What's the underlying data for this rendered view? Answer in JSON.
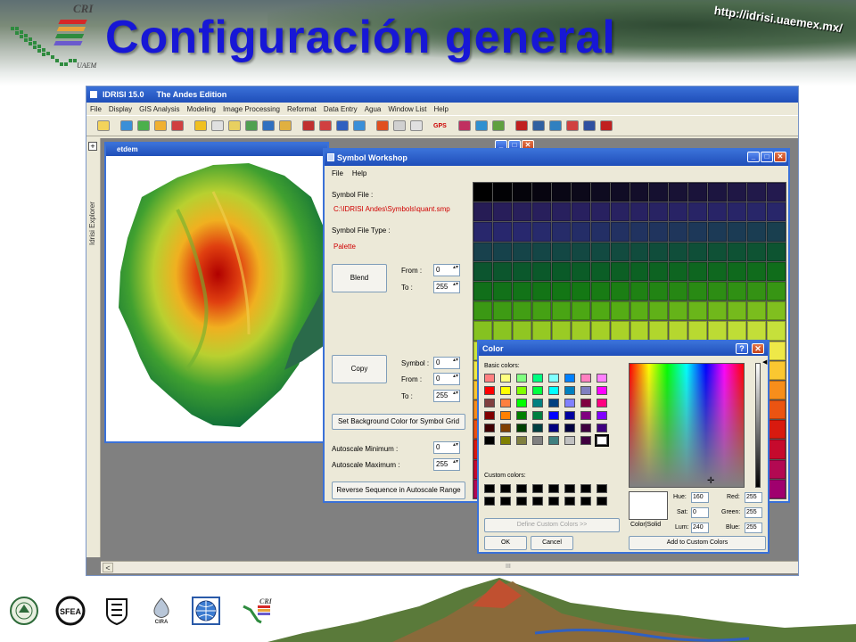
{
  "slide": {
    "title": "Configuración general",
    "url": "http://idrisi.uaemex.mx/",
    "header_logo_text_top": "CRI",
    "header_logo_text_bottom": "UAEM"
  },
  "app": {
    "title": "IDRISI 15.0",
    "edition": "The Andes Edition",
    "menu": [
      "File",
      "Display",
      "GIS Analysis",
      "Modeling",
      "Image Processing",
      "Reformat",
      "Data Entry",
      "Agua",
      "Window List",
      "Help"
    ],
    "toolbar_icons": [
      "open-icon",
      "display-icon",
      "composite-icon",
      "arrows-icon",
      "layer-icon",
      "palette-icon",
      "series-icon",
      "image-icon",
      "legend-icon",
      "histogram-icon",
      "map-icon",
      "stats-icon",
      "help-icon",
      "gps-label",
      "chart-icon",
      "wave-icon",
      "terrain-icon",
      "import-icon",
      "table-icon",
      "grid-icon",
      "tools-icon",
      "symbol-icon"
    ],
    "gps_label": "GPS",
    "explorer_label": "Idrisi Explorer",
    "explorer_plus": "+",
    "scroll_left": "<",
    "scroll_grip": "III"
  },
  "etdem": {
    "title": "etdem"
  },
  "symbol_workshop": {
    "title": "Symbol Workshop",
    "menu": [
      "File",
      "Help"
    ],
    "symbol_file_label": "Symbol File :",
    "symbol_file_path": "C:\\IDRISI Andes\\Symbols\\quant.smp",
    "symbol_file_type_label": "Symbol File Type :",
    "symbol_file_type": "Palette",
    "blend_label": "Blend",
    "from_label": "From :",
    "to_label": "To :",
    "blend_from": "0",
    "blend_to": "255",
    "copy_label": "Copy",
    "symbol_label": "Symbol :",
    "copy_symbol": "0",
    "copy_from": "0",
    "copy_to": "255",
    "set_bg_label": "Set Background Color for Symbol Grid",
    "autoscale_min_label": "Autoscale Minimum :",
    "autoscale_max_label": "Autoscale Maximum :",
    "autoscale_min": "0",
    "autoscale_max": "255",
    "reverse_label": "Reverse Sequence in Autoscale Range"
  },
  "color_dialog": {
    "title": "Color",
    "help": "?",
    "close": "✕",
    "basic_colors_label": "Basic colors:",
    "custom_colors_label": "Custom colors:",
    "define_custom_label": "Define Custom Colors >>",
    "ok_label": "OK",
    "cancel_label": "Cancel",
    "color_solid_label": "Color|Solid",
    "hue_label": "Hue:",
    "sat_label": "Sat:",
    "lum_label": "Lum:",
    "red_label": "Red:",
    "green_label": "Green:",
    "blue_label": "Blue:",
    "hue": "160",
    "sat": "0",
    "lum": "240",
    "red": "255",
    "green": "255",
    "blue": "255",
    "add_custom_label": "Add to Custom Colors",
    "basic_colors": [
      "#ff8080",
      "#ffff80",
      "#80ff80",
      "#00ff80",
      "#80ffff",
      "#0080ff",
      "#ff80c0",
      "#ff80ff",
      "#ff0000",
      "#ffff00",
      "#80ff00",
      "#00ff40",
      "#00ffff",
      "#0080c0",
      "#8080c0",
      "#ff00ff",
      "#804040",
      "#ff8040",
      "#00ff00",
      "#008080",
      "#004080",
      "#8080ff",
      "#800040",
      "#ff0080",
      "#800000",
      "#ff8000",
      "#008000",
      "#008040",
      "#0000ff",
      "#0000a0",
      "#800080",
      "#8000ff",
      "#400000",
      "#804000",
      "#004000",
      "#004040",
      "#000080",
      "#000040",
      "#400040",
      "#400080",
      "#000000",
      "#808000",
      "#808040",
      "#808080",
      "#408080",
      "#c0c0c0",
      "#400040",
      "#ffffff"
    ],
    "selected_basic_index": 47
  },
  "footer": {
    "logos": [
      "uaem-seal-logo",
      "sfea-logo",
      "shield-logo",
      "cira-logo",
      "globe-logo",
      "cri-logo"
    ],
    "cira_label": "CIRA",
    "cri_label": "CRI"
  }
}
